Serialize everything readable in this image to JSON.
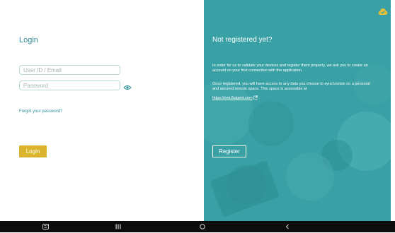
{
  "login": {
    "title": "Login",
    "userid_placeholder": "User ID / Email",
    "userid_value": "",
    "password_placeholder": "Password",
    "password_value": "",
    "forgot_label": "Forgot your password?",
    "button_label": "Login",
    "button_color": "#dab42c",
    "accent": "#2f8f98"
  },
  "register": {
    "title": "Not registered yet?",
    "paragraph1": "In order for us to validate your devices and register them properly, we ask you to create an account on your first connection with the application.",
    "paragraph2": "Once registered, you will have access to any data you choose to synchronize on a personal and secured remote space. This space is accessible at",
    "link": "https://omi.fluigent.com",
    "button_label": "Register",
    "panel_color": "#39a1a5",
    "status_icon": "cloud-check-icon"
  },
  "nav_bar": {
    "icons": [
      "keyboard-icon",
      "recents-icon",
      "home-icon",
      "back-icon"
    ]
  }
}
